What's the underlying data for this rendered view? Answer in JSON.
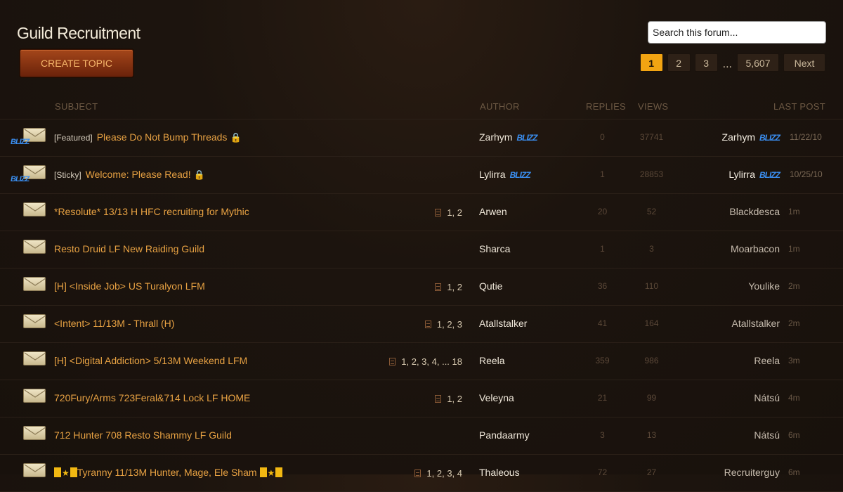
{
  "header": {
    "title": "Guild Recruitment",
    "create_topic": "CREATE TOPIC",
    "search_placeholder": "Search this forum..."
  },
  "pagination": {
    "pages": [
      "1",
      "2",
      "3"
    ],
    "ellipsis": "...",
    "last": "5,607",
    "next": "Next",
    "current": "1"
  },
  "columns": {
    "subject": "SUBJECT",
    "author": "AUTHOR",
    "replies": "REPLIES",
    "views": "VIEWS",
    "last_post": "LAST POST"
  },
  "topics": [
    {
      "tag": "[Featured]",
      "title": "Please Do Not Bump Threads",
      "locked": true,
      "pages": "",
      "author": "Zarhym",
      "author_staff": true,
      "replies": "0",
      "views": "37741",
      "last_author": "Zarhym",
      "last_staff": true,
      "last_time": "11/22/10"
    },
    {
      "tag": "[Sticky]",
      "title": "Welcome: Please Read!",
      "locked": true,
      "pages": "",
      "author": "Lylirra",
      "author_staff": true,
      "replies": "1",
      "views": "28853",
      "last_author": "Lylirra",
      "last_staff": true,
      "last_time": "10/25/10"
    },
    {
      "tag": "",
      "title": "*Resolute* 13/13 H HFC recruiting for Mythic",
      "locked": false,
      "pages": "1, 2",
      "author": "Arwen",
      "author_staff": false,
      "replies": "20",
      "views": "52",
      "last_author": "Blackdesca",
      "last_staff": false,
      "last_time": "1m"
    },
    {
      "tag": "",
      "title": "Resto Druid LF New Raiding Guild",
      "locked": false,
      "pages": "",
      "author": "Sharca",
      "author_staff": false,
      "replies": "1",
      "views": "3",
      "last_author": "Moarbacon",
      "last_staff": false,
      "last_time": "1m"
    },
    {
      "tag": "",
      "title": "[H] <Inside Job> US Turalyon LFM",
      "locked": false,
      "pages": "1, 2",
      "author": "Qutie",
      "author_staff": false,
      "replies": "36",
      "views": "110",
      "last_author": "Youlike",
      "last_staff": false,
      "last_time": "2m"
    },
    {
      "tag": "",
      "title": "<Intent> 11/13M - Thrall (H)",
      "locked": false,
      "pages": "1, 2, 3",
      "author": "Atallstalker",
      "author_staff": false,
      "replies": "41",
      "views": "164",
      "last_author": "Atallstalker",
      "last_staff": false,
      "last_time": "2m"
    },
    {
      "tag": "",
      "title": "[H] <Digital Addiction> 5/13M Weekend LFM",
      "locked": false,
      "pages": "1, 2, 3, 4, ... 18",
      "author": "Reela",
      "author_staff": false,
      "replies": "359",
      "views": "986",
      "last_author": "Reela",
      "last_staff": false,
      "last_time": "3m"
    },
    {
      "tag": "",
      "title": "720Fury/Arms 723Feral&714 Lock LF HOME",
      "locked": false,
      "pages": "1, 2",
      "author": "Veleyna",
      "author_staff": false,
      "replies": "21",
      "views": "99",
      "last_author": "Nátsú",
      "last_staff": false,
      "last_time": "4m"
    },
    {
      "tag": "",
      "title": "712 Hunter 708 Resto Shammy LF Guild",
      "locked": false,
      "pages": "",
      "author": "Pandaarmy",
      "author_staff": false,
      "replies": "3",
      "views": "13",
      "last_author": "Nátsú",
      "last_staff": false,
      "last_time": "6m"
    },
    {
      "tag": "",
      "title": "Tyranny 11/13M Hunter, Mage, Ele Sham",
      "starred": true,
      "locked": false,
      "pages": "1, 2, 3, 4",
      "author": "Thaleous",
      "author_staff": false,
      "replies": "72",
      "views": "27",
      "last_author": "Recruiterguy",
      "last_staff": false,
      "last_time": "6m"
    }
  ],
  "staff_badge": "BLIZZ",
  "colors": {
    "accent": "#f2a412",
    "link": "#e8a243",
    "button": "#8a3412",
    "staff": "#3a8ef0"
  }
}
